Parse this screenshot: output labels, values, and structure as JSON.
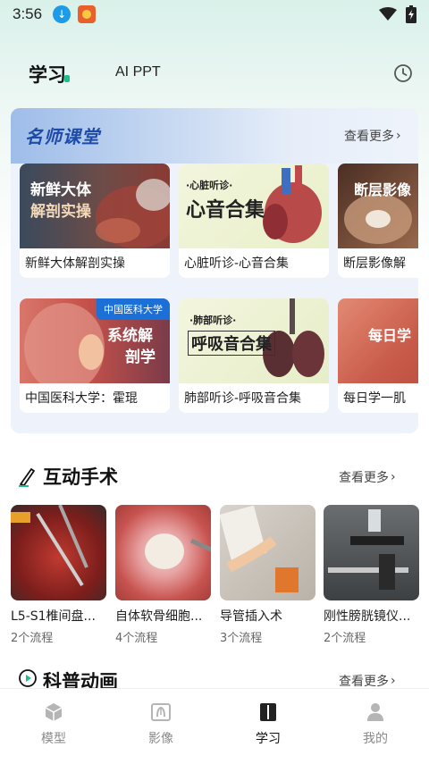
{
  "status_bar": {
    "time": "3:56"
  },
  "header": {
    "tabs": [
      {
        "label": "学习",
        "active": true
      },
      {
        "label": "AI PPT",
        "active": false
      }
    ],
    "history_icon": "clock-icon"
  },
  "famous_teachers": {
    "title": "名师课堂",
    "more_label": "查看更多",
    "courses": [
      {
        "title": "新鲜大体解剖实操",
        "thumb_text": [
          "新鲜大体",
          "解剖实操"
        ]
      },
      {
        "title": "心脏听诊-心音合集",
        "thumb_tag": "·心脏听诊·",
        "thumb_text": [
          "心音合集"
        ]
      },
      {
        "title": "断层影像解",
        "thumb_text": [
          "断层影像"
        ]
      },
      {
        "title": "中国医科大学：霍琨",
        "thumb_tag": "中国医科大学",
        "thumb_text": [
          "系统解",
          "剖学"
        ]
      },
      {
        "title": "肺部听诊-呼吸音合集",
        "thumb_tag": "·肺部听诊·",
        "thumb_text": [
          "呼吸音合集"
        ]
      },
      {
        "title": "每日学一肌",
        "thumb_text": [
          "每日学"
        ]
      }
    ]
  },
  "interactive_surgery": {
    "title": "互动手术",
    "more_label": "查看更多",
    "items": [
      {
        "name": "L5-S1椎间盘...",
        "count": "2个流程"
      },
      {
        "name": "自体软骨细胞...",
        "count": "4个流程"
      },
      {
        "name": "导管插入术",
        "count": "3个流程"
      },
      {
        "name": "刚性膀胱镜仪...",
        "count": "2个流程"
      }
    ]
  },
  "science_animation": {
    "title": "科普动画",
    "more_label": "查看更多"
  },
  "bottom_nav": [
    {
      "label": "模型",
      "icon": "cube-icon",
      "active": false
    },
    {
      "label": "影像",
      "icon": "xray-icon",
      "active": false
    },
    {
      "label": "学习",
      "icon": "book-icon",
      "active": true
    },
    {
      "label": "我的",
      "icon": "person-icon",
      "active": false
    }
  ],
  "colors": {
    "accent": "#1bc08d",
    "famous_title": "#1e4ba8",
    "card_bg": "#eef3fb"
  }
}
